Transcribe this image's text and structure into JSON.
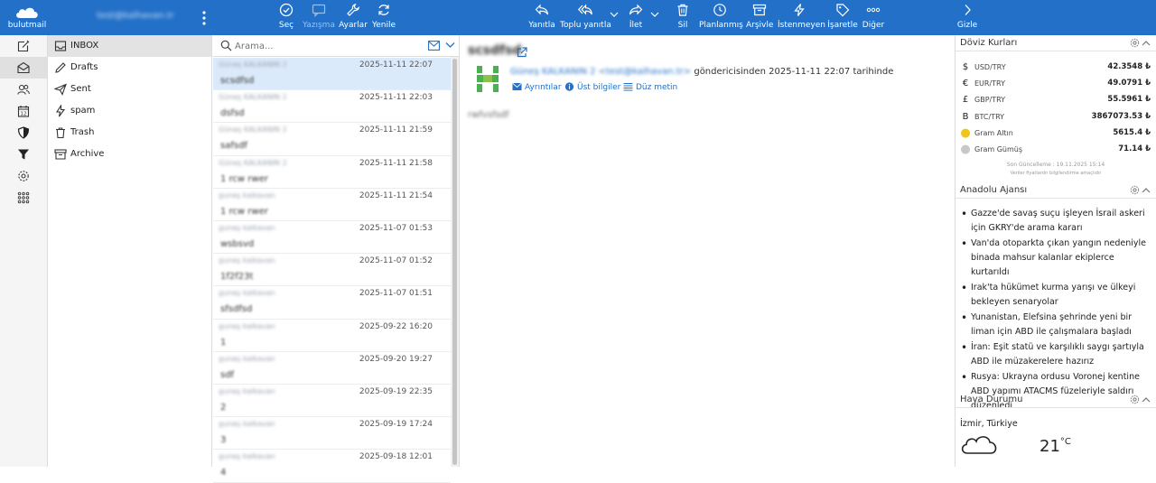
{
  "app": {
    "logo_text": "bulutmail",
    "account": "test@kalhavan.tr"
  },
  "toolbar": {
    "left": [
      {
        "name": "select",
        "label": "Seç",
        "icon": "check-circle-icon"
      },
      {
        "name": "compose",
        "label": "Yazışma",
        "icon": "compose-icon"
      },
      {
        "name": "settings",
        "label": "Ayarlar",
        "icon": "wrench-icon"
      },
      {
        "name": "refresh",
        "label": "Yenile",
        "icon": "refresh-icon"
      }
    ],
    "right": [
      {
        "name": "reply",
        "label": "Yanıtla",
        "icon": "reply-icon"
      },
      {
        "name": "reply-all",
        "label": "Toplu yanıtla",
        "icon": "reply-all-icon"
      },
      {
        "name": "forward",
        "label": "İlet",
        "icon": "forward-icon"
      },
      {
        "name": "delete",
        "label": "Sil",
        "icon": "trash-icon"
      },
      {
        "name": "scheduled",
        "label": "Planlanmış",
        "icon": "clock-icon"
      },
      {
        "name": "archive",
        "label": "Arşivle",
        "icon": "archive-icon"
      },
      {
        "name": "junk",
        "label": "İstenmeyen",
        "icon": "lightning-icon"
      },
      {
        "name": "mark",
        "label": "İşaretle",
        "icon": "tag-icon"
      },
      {
        "name": "more",
        "label": "Diğer",
        "icon": "more-icon"
      },
      {
        "name": "hide",
        "label": "Gizle",
        "icon": "chevron-right-icon"
      }
    ]
  },
  "folders": [
    {
      "name": "INBOX",
      "icon": "inbox-icon"
    },
    {
      "name": "Drafts",
      "icon": "drafts-icon"
    },
    {
      "name": "Sent",
      "icon": "sent-icon"
    },
    {
      "name": "spam",
      "icon": "spam-icon"
    },
    {
      "name": "Trash",
      "icon": "trash-icon"
    },
    {
      "name": "Archive",
      "icon": "archive-icon"
    }
  ],
  "search": {
    "placeholder": "Arama..."
  },
  "messages": [
    {
      "from": "Güneş KALKANIN 2",
      "date": "2025-11-11 22:07",
      "subject": "scsdfsd"
    },
    {
      "from": "Güneş KALKANIN 2",
      "date": "2025-11-11 22:03",
      "subject": "dsfsd"
    },
    {
      "from": "Güneş KALKANIN 2",
      "date": "2025-11-11 21:59",
      "subject": "safsdf"
    },
    {
      "from": "Güneş KALKANIN 2",
      "date": "2025-11-11 21:58",
      "subject": "1 rcw rwer"
    },
    {
      "from": "guneş kalkavan",
      "date": "2025-11-11 21:54",
      "subject": "1 rcw rwer"
    },
    {
      "from": "guneş kalkavan",
      "date": "2025-11-07 01:53",
      "subject": "wsbsvd"
    },
    {
      "from": "guneş kalkavan",
      "date": "2025-11-07 01:52",
      "subject": "1f2f23t"
    },
    {
      "from": "guneş kalkavan",
      "date": "2025-11-07 01:51",
      "subject": "sfsdfsd"
    },
    {
      "from": "guneş kalkavan",
      "date": "2025-09-22 16:20",
      "subject": "1"
    },
    {
      "from": "guneş kalkavan",
      "date": "2025-09-20 19:27",
      "subject": "sdf"
    },
    {
      "from": "guneş kalkavan",
      "date": "2025-09-19 22:35",
      "subject": "2"
    },
    {
      "from": "guneş kalkavan",
      "date": "2025-09-19 17:24",
      "subject": "3"
    },
    {
      "from": "guneş kalkavan",
      "date": "2025-09-18 12:01",
      "subject": "4"
    }
  ],
  "reader": {
    "subject": "scsdfsd",
    "sender_name": "Güneş KALKANIN 2 <test@kalhavan.tr>",
    "sender_text": "göndericisinden 2025-11-11 22:07 tarihinde",
    "links": [
      "Ayrıntılar",
      "Üst bilgiler",
      "Düz metin"
    ],
    "body": "rwfvsfsdf"
  },
  "widgets": {
    "fx": {
      "title": "Döviz Kurları",
      "rows": [
        {
          "sym": "$",
          "name": "USD/TRY",
          "value": "42.3548 ₺"
        },
        {
          "sym": "€",
          "name": "EUR/TRY",
          "value": "49.0791 ₺"
        },
        {
          "sym": "£",
          "name": "GBP/TRY",
          "value": "55.5961 ₺"
        },
        {
          "sym": "B",
          "name": "BTC/TRY",
          "value": "3867073.53 ₺"
        },
        {
          "sym": "●",
          "name": "Gram Altın",
          "value": "5615.4 ₺",
          "color": "#f0c419"
        },
        {
          "sym": "●",
          "name": "Gram Gümüş",
          "value": "71.14 ₺",
          "color": "#c8c8c8"
        }
      ],
      "updated": "Son Güncelleme : 19.11.2025 15:14",
      "note": "Veriler fiyatlardır bilgilendirme amaçlıdır"
    },
    "news": {
      "title": "Anadolu Ajansı",
      "items": [
        "Gazze'de savaş suçu işleyen İsrail askeri için GKRY'de arama kararı",
        "Van'da otoparkta çıkan yangın nedeniyle binada mahsur kalanlar ekiplerce kurtarıldı",
        "Irak'ta hükümet kurma yarışı ve ülkeyi bekleyen senaryolar",
        "Yunanistan, Elefsina şehrinde yeni bir liman için ABD ile çalışmalara başladı",
        "İran: Eşit statü ve karşılıklı saygı şartıyla ABD ile müzakerelere hazırız",
        "Rusya: Ukrayna ordusu Voronej kentine ABD yapımı ATACMS füzeleriyle saldırı düzenledi"
      ]
    },
    "weather": {
      "title": "Hava Durumu",
      "city": "İzmir, Türkiye",
      "temp": "21",
      "unit": "°C"
    }
  },
  "colors": {
    "brand": "#2270c8",
    "selected_row": "#dbeafb",
    "link": "#2270c8"
  }
}
